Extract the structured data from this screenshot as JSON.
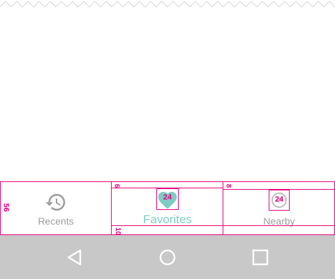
{
  "bottom_nav": {
    "items": [
      {
        "label": "Recents",
        "icon": "history-icon",
        "active": false
      },
      {
        "label": "Favorites",
        "icon": "heart-icon",
        "active": true
      },
      {
        "label": "Nearby",
        "icon": "location-icon",
        "active": false
      }
    ]
  },
  "spec": {
    "nav_height": "56",
    "icon_size_favorites": "24",
    "icon_size_nearby": "24",
    "top_padding_active": "6",
    "top_padding_inactive": "8",
    "bottom_padding": "10"
  },
  "system_nav": {
    "buttons": [
      "back-icon",
      "home-icon",
      "recents-apps-icon"
    ]
  },
  "colors": {
    "spec_magenta": "#e6007e",
    "active_teal": "#80cbc4",
    "inactive_gray": "#9e9e9e",
    "system_bar": "#c8c8c8"
  }
}
